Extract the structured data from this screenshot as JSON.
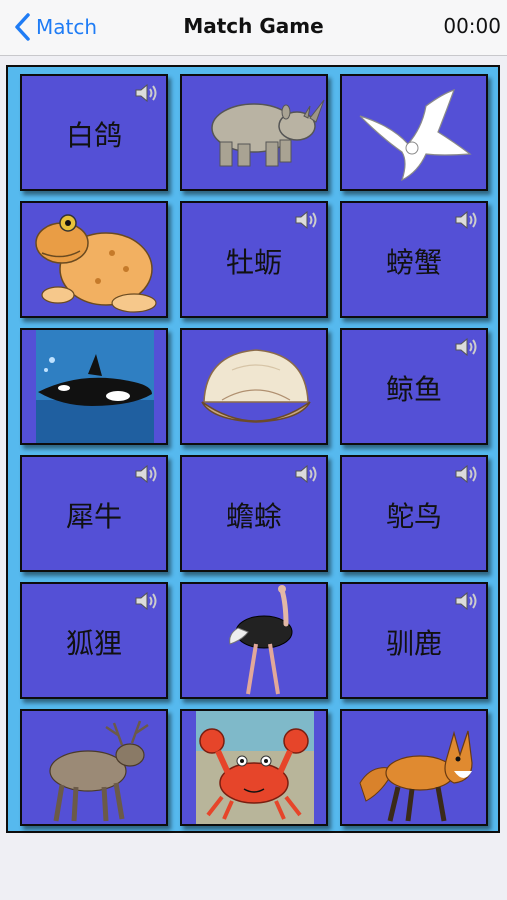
{
  "nav": {
    "back_label": "Match",
    "title": "Match Game",
    "timer": "00:00"
  },
  "cards": [
    {
      "kind": "word",
      "text": "白鸽"
    },
    {
      "kind": "image",
      "icon": "rhino-icon"
    },
    {
      "kind": "image",
      "icon": "dove-icon"
    },
    {
      "kind": "image",
      "icon": "toad-icon"
    },
    {
      "kind": "word",
      "text": "牡蛎"
    },
    {
      "kind": "word",
      "text": "螃蟹"
    },
    {
      "kind": "image",
      "icon": "orca-icon"
    },
    {
      "kind": "image",
      "icon": "oyster-icon"
    },
    {
      "kind": "word",
      "text": "鲸鱼"
    },
    {
      "kind": "word",
      "text": "犀牛"
    },
    {
      "kind": "word",
      "text": "蟾蜍"
    },
    {
      "kind": "word",
      "text": "鸵鸟"
    },
    {
      "kind": "word",
      "text": "狐狸"
    },
    {
      "kind": "image",
      "icon": "ostrich-icon"
    },
    {
      "kind": "word",
      "text": "驯鹿"
    },
    {
      "kind": "image",
      "icon": "reindeer-icon"
    },
    {
      "kind": "image",
      "icon": "crab-icon"
    },
    {
      "kind": "image",
      "icon": "fox-icon"
    }
  ],
  "colors": {
    "accent": "#1f7cf5",
    "board": "#56b9ee",
    "card": "#5450d6"
  }
}
